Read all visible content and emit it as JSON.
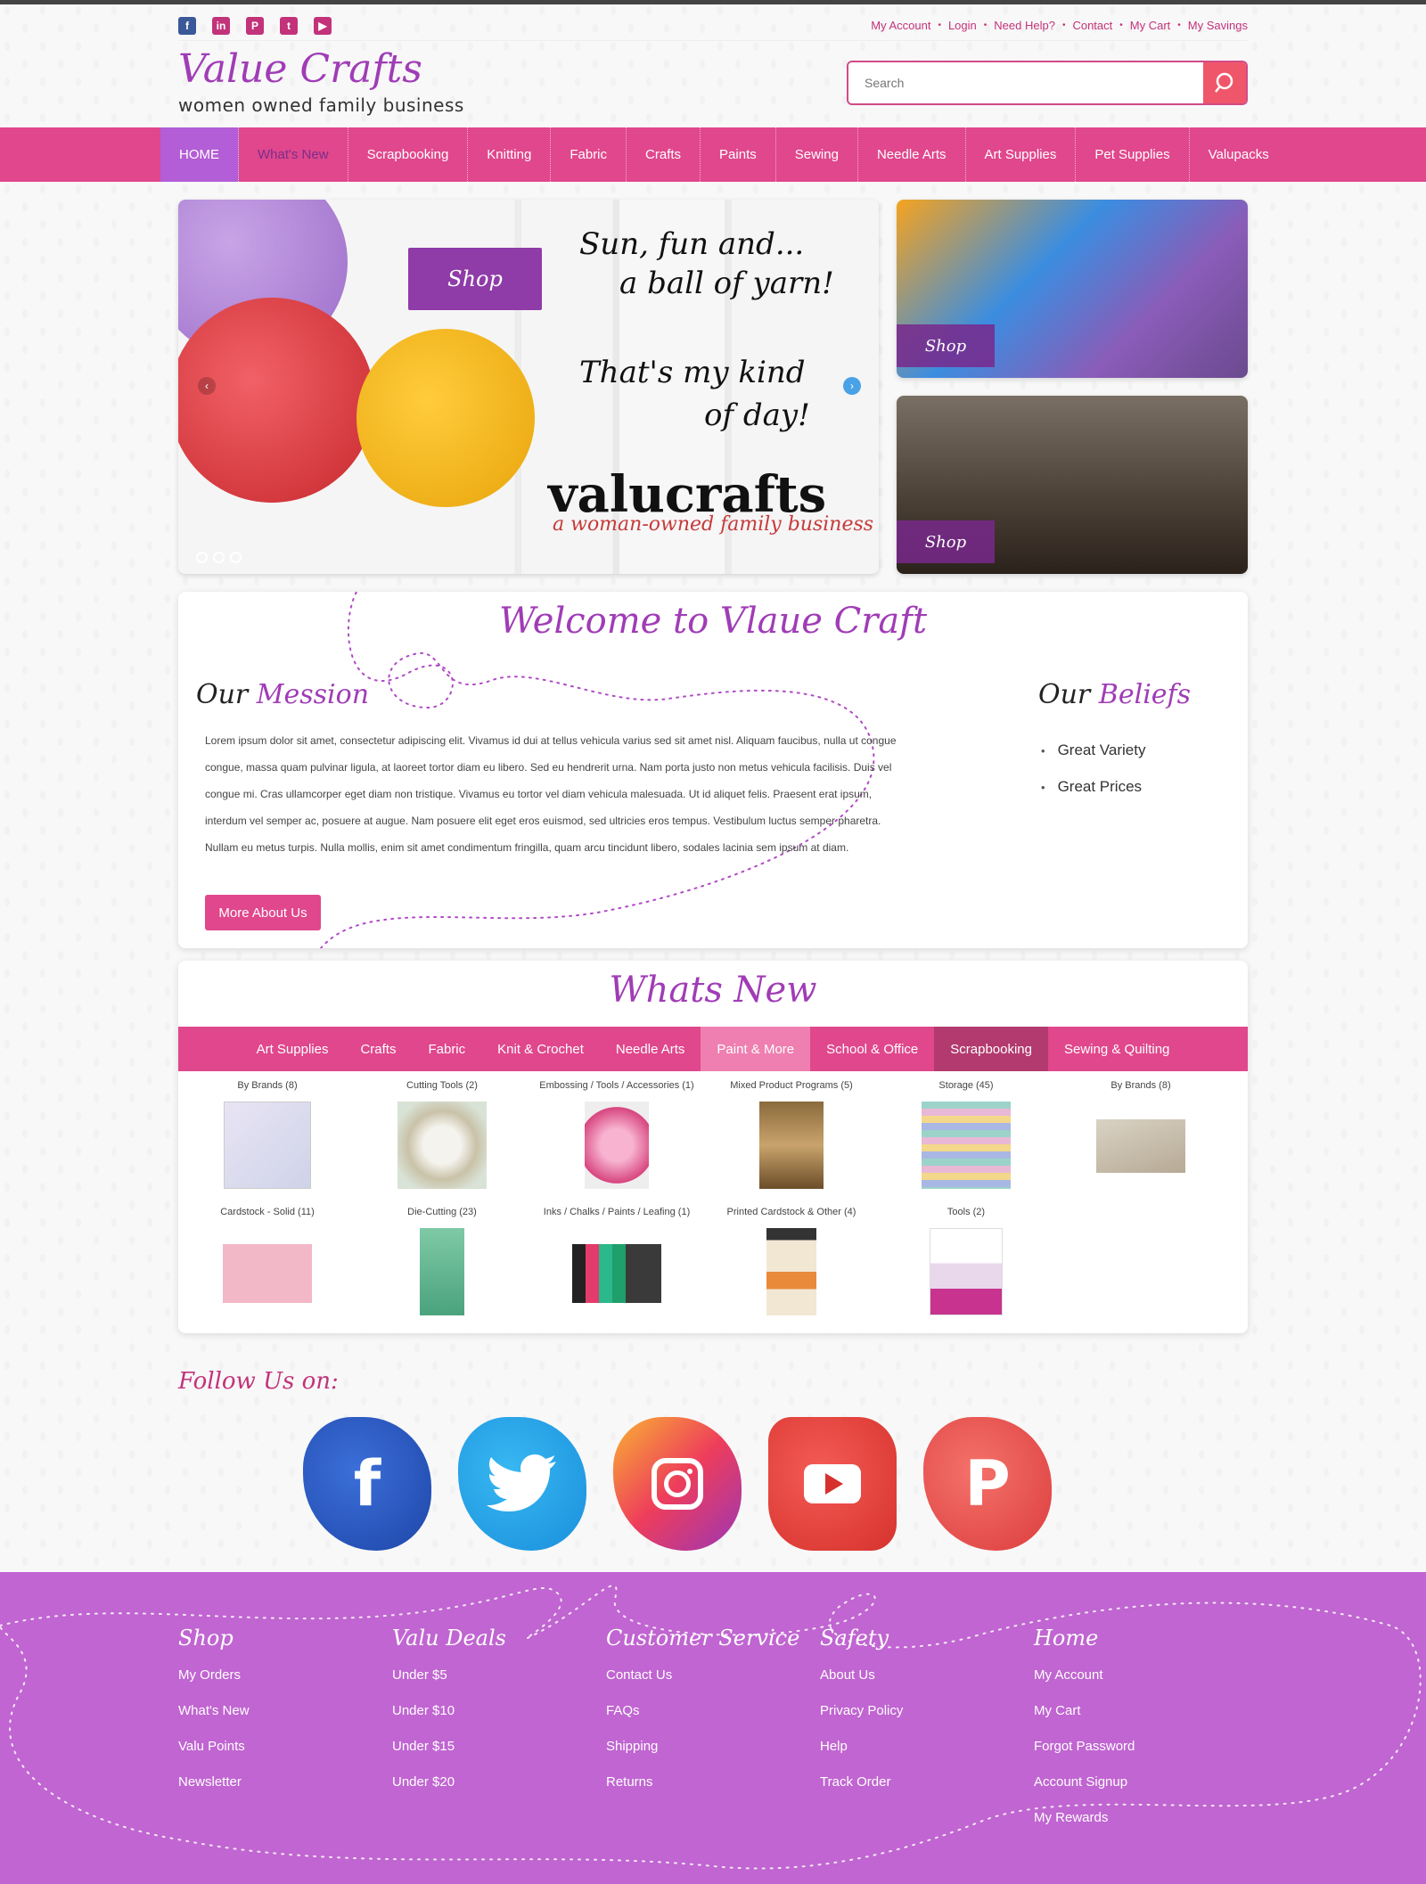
{
  "utility": {
    "social": [
      "facebook-icon",
      "linkedin-icon",
      "pinterest-icon",
      "twitter-icon",
      "youtube-icon"
    ],
    "links": [
      "My Account",
      "Login",
      "Need Help?",
      "Contact",
      "My Cart",
      "My Savings"
    ]
  },
  "brand": {
    "title": "Value Crafts",
    "tagline": "women owned family business"
  },
  "search": {
    "placeholder": "Search"
  },
  "nav": [
    "HOME",
    "What's New",
    "Scrapbooking",
    "Knitting",
    "Fabric",
    "Crafts",
    "Paints",
    "Sewing",
    "Needle Arts",
    "Art Supplies",
    "Pet Supplies",
    "Valupacks"
  ],
  "hero": {
    "shop_label": "Shop",
    "line1": "Sun, fun and...",
    "line2": "a ball of yarn!",
    "line3": "That's my kind",
    "line4": "of day!",
    "brand": "valucrafts",
    "sub": "a woman-owned family business"
  },
  "promos": [
    {
      "label": "Shop"
    },
    {
      "label": "Shop"
    }
  ],
  "welcome": {
    "title": "Welcome to Vlaue Craft",
    "mission_a": "Our ",
    "mission_b": "Mession",
    "mission_text": "Lorem ipsum dolor sit amet, consectetur adipiscing elit. Vivamus id dui at tellus vehicula varius sed sit amet nisl. Aliquam faucibus, nulla ut congue congue, massa quam pulvinar ligula, at laoreet tortor diam eu libero. Sed eu hendrerit urna. Nam porta justo non metus vehicula facilisis. Duis vel congue mi. Cras ullamcorper eget diam non tristique. Vivamus eu tortor vel diam vehicula malesuada. Ut id aliquet felis. Praesent erat ipsum, interdum vel semper ac, posuere at augue. Nam posuere elit eget eros euismod, sed ultricies eros tempus. Vestibulum luctus semper pharetra. Nullam eu metus turpis. Nulla mollis, enim sit amet condimentum fringilla, quam arcu tincidunt libero, sodales lacinia sem ipsum at diam.",
    "more_button": "More About Us",
    "beliefs_a": "Our ",
    "beliefs_b": "Beliefs",
    "beliefs": [
      "Great Variety",
      "Great Prices"
    ]
  },
  "whats_new": {
    "title": "Whats New",
    "tabs": [
      "Art Supplies",
      "Crafts",
      "Fabric",
      "Knit & Crochet",
      "Needle Arts",
      "Paint & More",
      "School & Office",
      "Scrapbooking",
      "Sewing & Quilting"
    ],
    "row1": [
      "By Brands (8)",
      "Cutting Tools (2)",
      "Embossing / Tools / Accessories (1)",
      "Mixed Product Programs (5)",
      "Storage (45)",
      "By Brands (8)"
    ],
    "row2": [
      "Cardstock - Solid (11)",
      "Die-Cutting (23)",
      "Inks / Chalks / Paints / Leafing (1)",
      "Printed Cardstock & Other (4)",
      "Tools (2)"
    ]
  },
  "follow": {
    "title": "Follow Us on:",
    "icons": [
      "facebook-icon",
      "twitter-icon",
      "instagram-icon",
      "youtube-icon",
      "pinterest-icon"
    ]
  },
  "footer": [
    {
      "head": "Shop",
      "links": [
        "My Orders",
        "What's New",
        "Valu Points",
        "Newsletter"
      ]
    },
    {
      "head": "Valu Deals",
      "links": [
        "Under $5",
        "Under $10",
        "Under $15",
        "Under $20"
      ]
    },
    {
      "head": "Customer Service",
      "links": [
        "Contact Us",
        "FAQs",
        "Shipping",
        "Returns"
      ]
    },
    {
      "head": "Safety",
      "links": [
        "About Us",
        "Privacy Policy",
        "Help",
        "Track Order"
      ]
    },
    {
      "head": "Home",
      "links": [
        "My Account",
        "My Cart",
        "Forgot Password",
        "Account Signup",
        "My Rewards"
      ]
    }
  ],
  "colors": {
    "brand_pink": "#e0478c",
    "brand_purple": "#a03cb6",
    "footer": "#c065d1"
  }
}
